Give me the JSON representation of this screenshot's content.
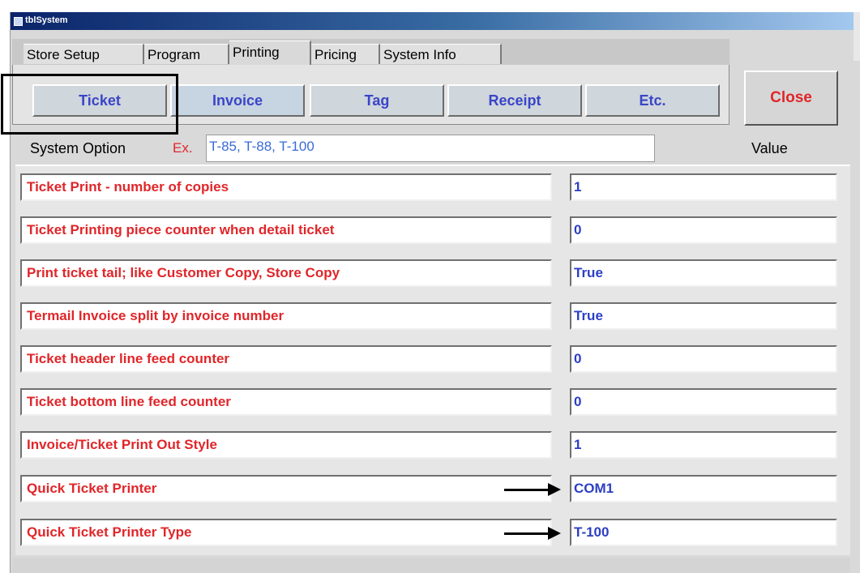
{
  "window": {
    "title": "tblSystem"
  },
  "tabs": [
    {
      "label": "Store Setup",
      "active": false
    },
    {
      "label": "Program",
      "active": false
    },
    {
      "label": "Printing",
      "active": true
    },
    {
      "label": "Pricing",
      "active": false
    },
    {
      "label": "System Info",
      "active": false
    }
  ],
  "subtabs": [
    "Ticket",
    "Invoice",
    "Tag",
    "Receipt",
    "Etc."
  ],
  "close_label": "Close",
  "header": {
    "system_option_label": "System Option",
    "example_label": "Ex.",
    "example_value": "T-85, T-88, T-100",
    "value_label": "Value"
  },
  "options": [
    {
      "name": "Ticket Print - number of copies",
      "value": "1"
    },
    {
      "name": "Ticket Printing piece counter when detail ticket",
      "value": "0"
    },
    {
      "name": "Print ticket tail; like Customer Copy, Store Copy",
      "value": "True"
    },
    {
      "name": "Termail Invoice split by invoice number",
      "value": "True"
    },
    {
      "name": "Ticket header line feed counter",
      "value": "0"
    },
    {
      "name": "Ticket bottom line feed counter",
      "value": "0"
    },
    {
      "name": "Invoice/Ticket Print Out Style",
      "value": "1"
    },
    {
      "name": "Quick Ticket Printer",
      "value": "COM1"
    },
    {
      "name": "Quick Ticket Printer Type",
      "value": "T-100"
    }
  ],
  "colors": {
    "option_text": "#e0262a",
    "value_text": "#2c3fc4",
    "subtab_text": "#3a45c8",
    "close_text": "#e0262a"
  }
}
